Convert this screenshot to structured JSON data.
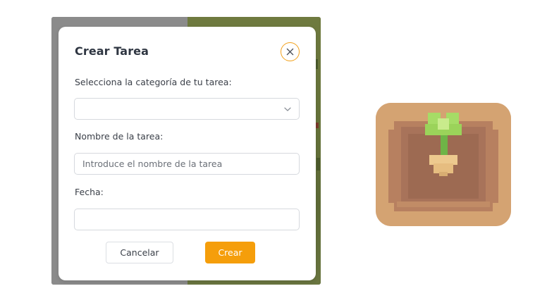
{
  "dialog": {
    "title": "Crear Tarea",
    "category_label": "Selecciona la categoría de tu tarea:",
    "category_value": "",
    "name_label": "Nombre de la tarea:",
    "name_placeholder": "Introduce el nombre de la tarea",
    "name_value": "",
    "date_label": "Fecha:",
    "date_value": "",
    "cancel_label": "Cancelar",
    "create_label": "Crear"
  },
  "colors": {
    "accent": "#f59e0b",
    "close_ring": "#f2a01a",
    "title_text": "#2f3642",
    "field_border": "#d6d9de",
    "icon_background": "#d3a271",
    "icon_soil": "#a8735a",
    "icon_sprout": "#9bd35a"
  },
  "icons": {
    "close": "close-icon",
    "dropdown": "chevron-down-icon",
    "app": "sprout-pot-icon"
  }
}
